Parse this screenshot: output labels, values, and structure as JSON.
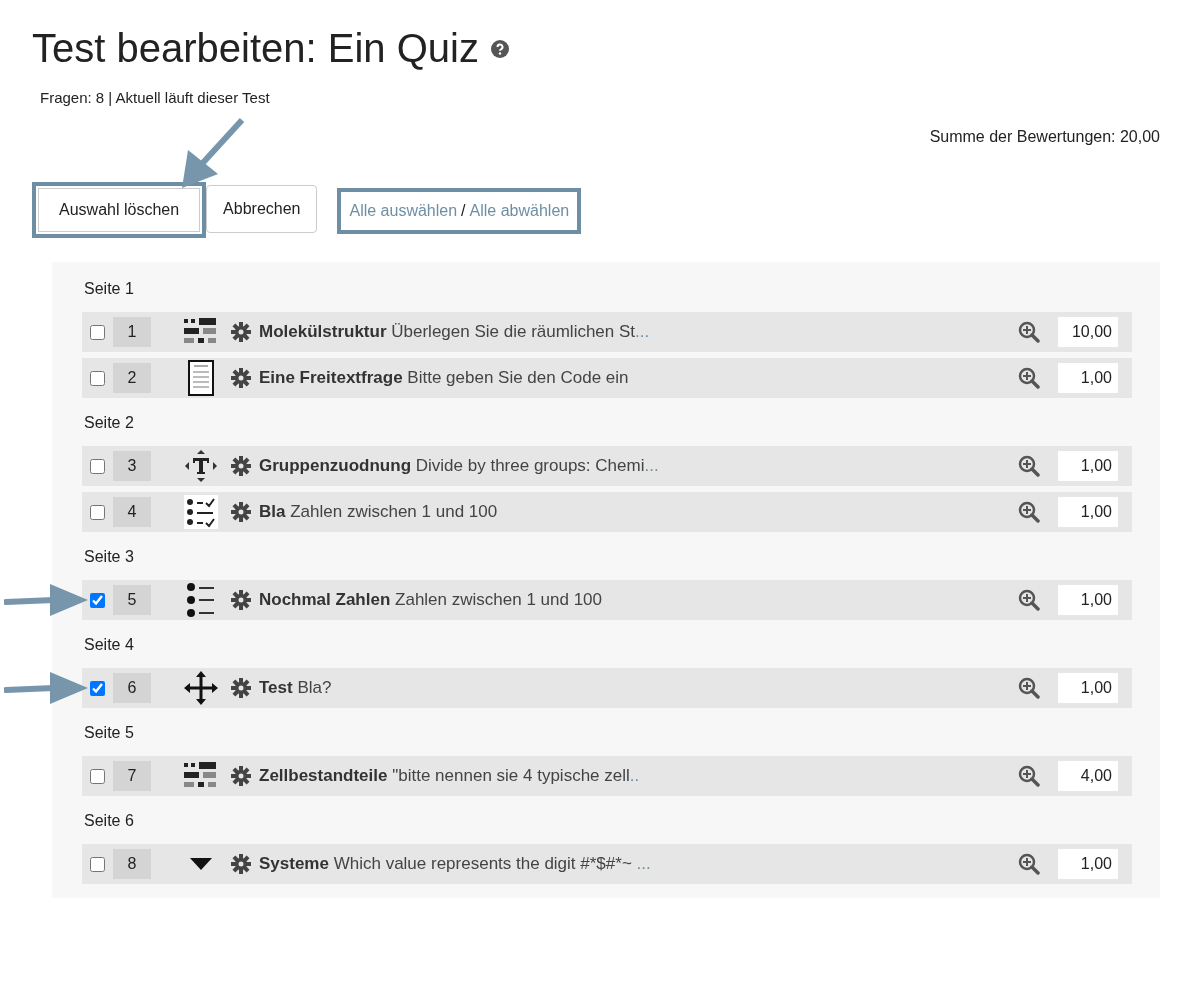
{
  "title": "Test bearbeiten: Ein Quiz",
  "info": "Fragen: 8 | Aktuell läuft dieser Test",
  "total": "Summe der Bewertungen: 20,00",
  "buttons": [
    "Auswahl löschen",
    "Abbrechen"
  ],
  "select_links": {
    "select_all": "Alle auswählen",
    "separator": "/",
    "deselect_all": "Alle abwählen"
  },
  "pages": [
    {
      "label": "Seite 1",
      "questions": [
        {
          "number": "1",
          "kind": "blocks",
          "checked": false,
          "name": "Molekülstruktur",
          "text": "Überlegen Sie die räumlichen St",
          "more": "...",
          "mark": "10,00"
        },
        {
          "number": "2",
          "kind": "document",
          "checked": false,
          "name": "Eine Freitextfrage",
          "text": "Bitte geben Sie den Code ein",
          "mark": "1,00"
        }
      ]
    },
    {
      "label": "Seite 2",
      "questions": [
        {
          "number": "3",
          "kind": "text-drag",
          "checked": false,
          "name": "Gruppenzuodnung",
          "text": "Divide by three groups: Chemi",
          "more": "...",
          "mark": "1,00"
        },
        {
          "number": "4",
          "kind": "checklist",
          "checked": false,
          "name": "Bla",
          "text": "Zahlen zwischen 1 und 100",
          "mark": "1,00"
        }
      ]
    },
    {
      "label": "Seite 3",
      "questions": [
        {
          "number": "5",
          "kind": "bullets",
          "checked": true,
          "name": "Nochmal Zahlen",
          "text": "Zahlen zwischen 1 und 100",
          "mark": "1,00"
        }
      ]
    },
    {
      "label": "Seite 4",
      "questions": [
        {
          "number": "6",
          "kind": "move",
          "checked": true,
          "name": "Test",
          "text": "Bla?",
          "mark": "1,00"
        }
      ]
    },
    {
      "label": "Seite 5",
      "questions": [
        {
          "number": "7",
          "kind": "blocks",
          "checked": false,
          "name": "Zellbestandteile",
          "text": "\"bitte nennen sie 4 typische zell",
          "more": "..",
          "mark": "4,00"
        }
      ]
    },
    {
      "label": "Seite 6",
      "questions": [
        {
          "number": "8",
          "kind": "caret",
          "checked": false,
          "name": "Systeme",
          "text": "Which value represents the digit #*$#*~ ",
          "more": "...",
          "mark": "1,00"
        }
      ]
    }
  ]
}
